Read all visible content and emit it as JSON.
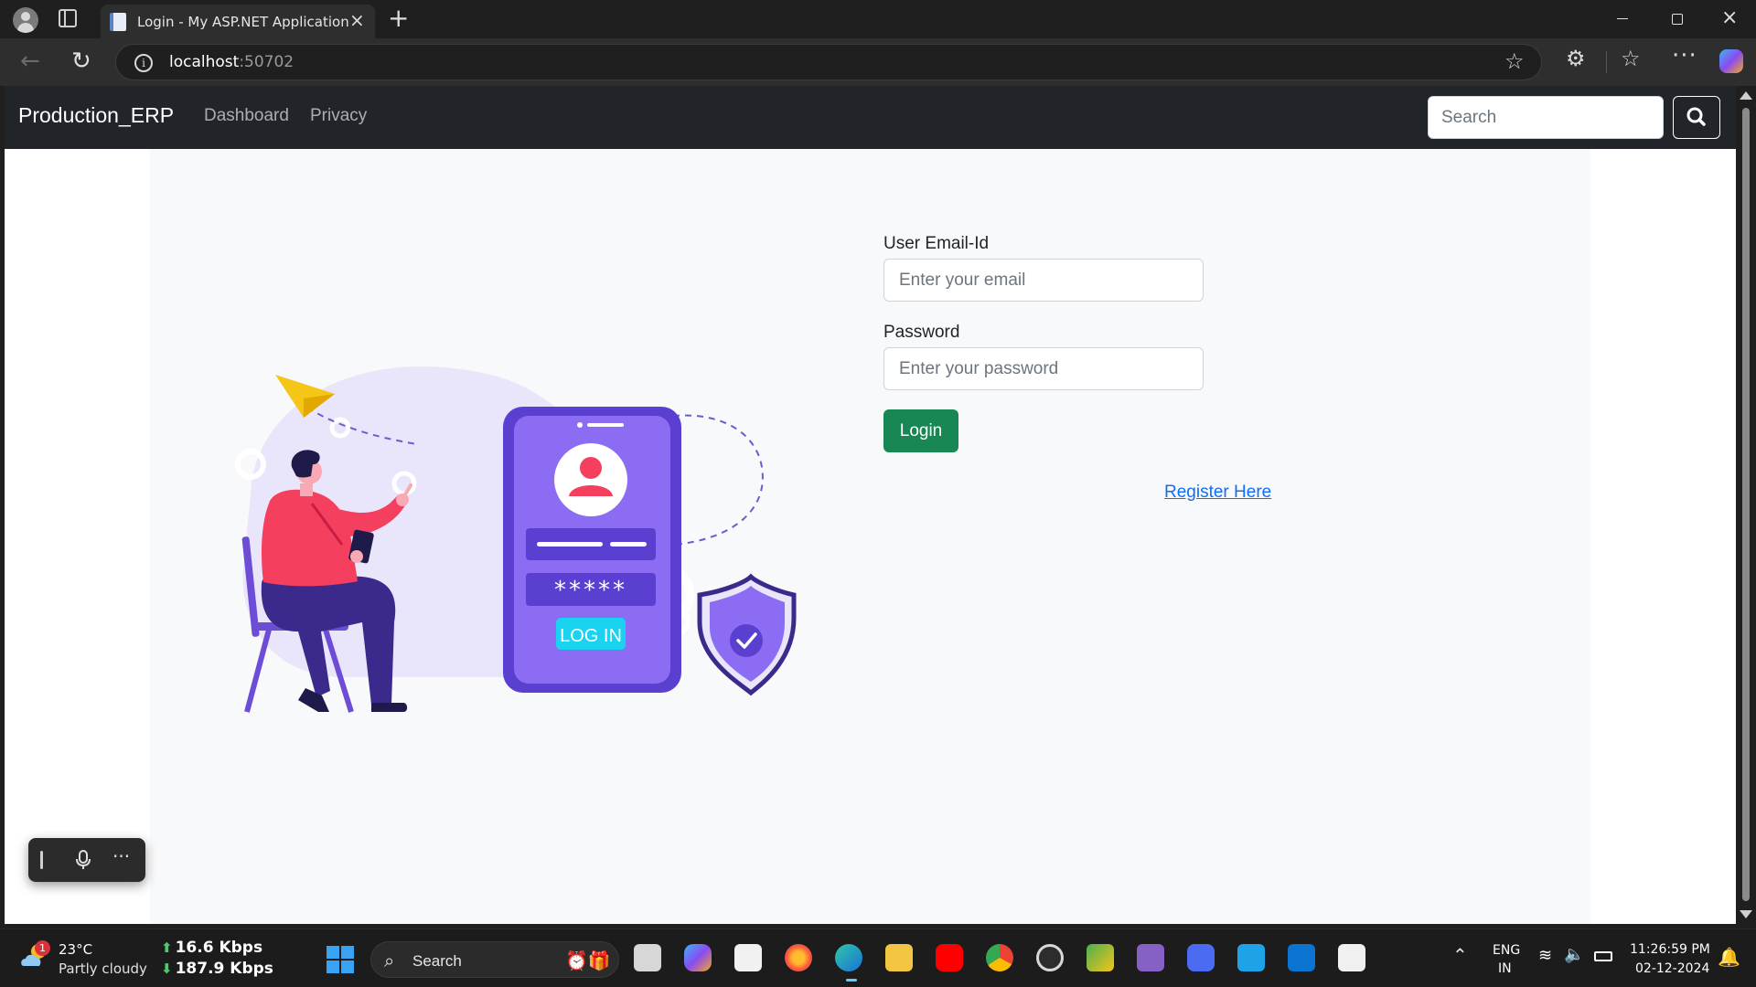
{
  "browser": {
    "tab_title": "Login - My ASP.NET Application",
    "url_host": "localhost",
    "url_port": ":50702"
  },
  "navbar": {
    "brand": "Production_ERP",
    "links": [
      "Dashboard",
      "Privacy"
    ],
    "search_placeholder": "Search"
  },
  "login": {
    "email_label": "User Email-Id",
    "email_placeholder": "Enter your email",
    "password_label": "Password",
    "password_placeholder": "Enter your password",
    "login_button": "Login",
    "register_link": "Register Here"
  },
  "illustration": {
    "stars": "*****",
    "button_text": "LOG IN"
  },
  "taskbar": {
    "weather_badge": "1",
    "weather_temp": "23°C",
    "weather_desc": "Partly cloudy",
    "net_up": "16.6 Kbps",
    "net_down": "187.9 Kbps",
    "search_label": "Search",
    "lang_line1": "ENG",
    "lang_line2": "IN",
    "time": "11:26:59 PM",
    "date": "02-12-2024"
  },
  "colors": {
    "navbar_bg": "#212529",
    "login_button": "#198754",
    "link": "#0d6efd",
    "illustration_purple": "#8b5cf6",
    "illustration_pink": "#f43f5e"
  }
}
